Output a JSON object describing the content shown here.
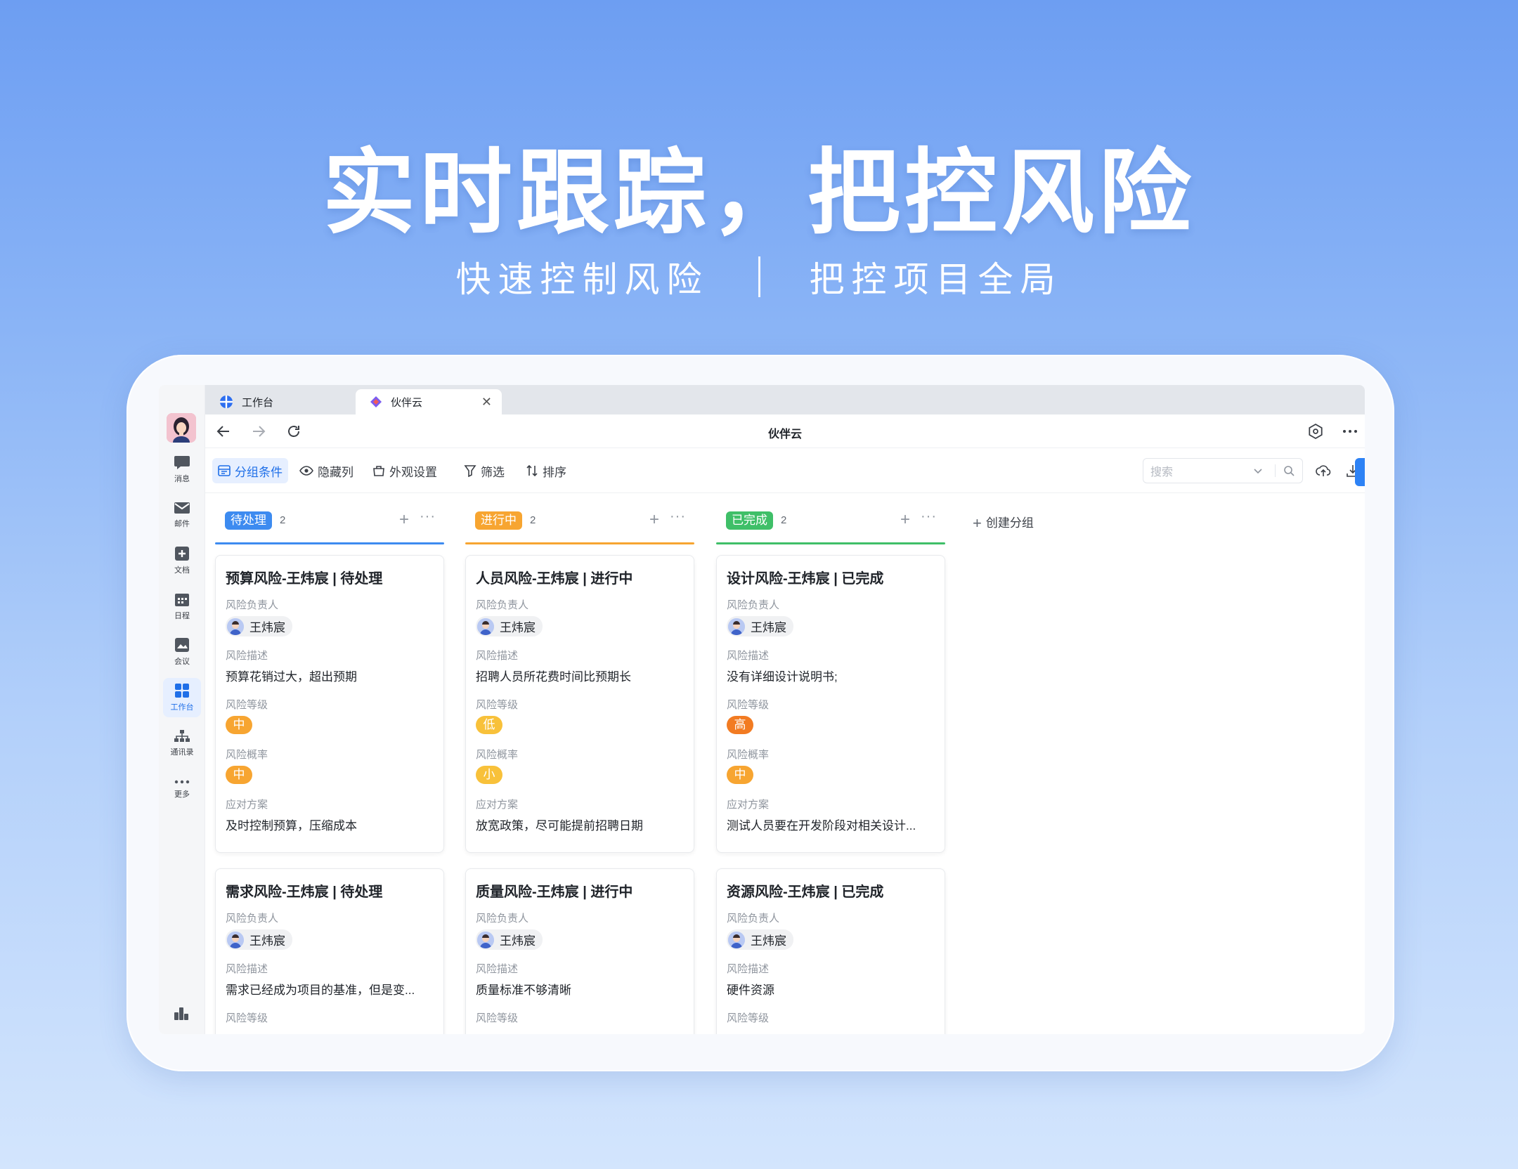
{
  "hero": {
    "title": "实时跟踪，把控风险",
    "subtitle_left": "快速控制风险",
    "subtitle_right": "把控项目全局"
  },
  "colors": {
    "accent": "#1f6fe8",
    "todo": "#3d8bf0",
    "doing": "#f7a531",
    "done": "#3fbf68",
    "level_mid": "#f7a531",
    "level_low": "#f8c13a",
    "level_high": "#f27b22"
  },
  "rail": {
    "items": [
      {
        "label": "消息",
        "icon": "message-icon"
      },
      {
        "label": "邮件",
        "icon": "mail-icon"
      },
      {
        "label": "文档",
        "icon": "doc-icon"
      },
      {
        "label": "日程",
        "icon": "calendar-icon"
      },
      {
        "label": "会议",
        "icon": "meeting-icon"
      },
      {
        "label": "工作台",
        "icon": "workbench-icon"
      },
      {
        "label": "通讯录",
        "icon": "contacts-icon"
      },
      {
        "label": "更多",
        "icon": "more-icon"
      }
    ]
  },
  "browser": {
    "tabs": [
      {
        "label": "工作台"
      },
      {
        "label": "伙伴云"
      }
    ],
    "title": "伙伴云"
  },
  "toolbar": {
    "group": "分组条件",
    "hide": "隐藏列",
    "appearance": "外观设置",
    "filter": "筛选",
    "sort": "排序",
    "search_placeholder": "搜索"
  },
  "board": {
    "create_group": "创建分组",
    "groups": [
      {
        "name": "待处理",
        "count": "2",
        "cards": [
          {
            "title": "预算风险-王炜宸 | 待处理",
            "owner_label": "风险负责人",
            "owner": "王炜宸",
            "desc_label": "风险描述",
            "desc": "预算花销过大，超出预期",
            "level_label": "风险等级",
            "level": "中",
            "prob_label": "风险概率",
            "prob": "中",
            "plan_label": "应对方案",
            "plan": "及时控制预算，压缩成本"
          },
          {
            "title": "需求风险-王炜宸 | 待处理",
            "owner_label": "风险负责人",
            "owner": "王炜宸",
            "desc_label": "风险描述",
            "desc": "需求已经成为项目的基准，但是变...",
            "level_label": "风险等级"
          }
        ]
      },
      {
        "name": "进行中",
        "count": "2",
        "cards": [
          {
            "title": "人员风险-王炜宸 | 进行中",
            "owner_label": "风险负责人",
            "owner": "王炜宸",
            "desc_label": "风险描述",
            "desc": "招聘人员所花费时间比预期长",
            "level_label": "风险等级",
            "level": "低",
            "prob_label": "风险概率",
            "prob": "小",
            "plan_label": "应对方案",
            "plan": "放宽政策，尽可能提前招聘日期"
          },
          {
            "title": "质量风险-王炜宸 | 进行中",
            "owner_label": "风险负责人",
            "owner": "王炜宸",
            "desc_label": "风险描述",
            "desc": "质量标准不够清晰",
            "level_label": "风险等级"
          }
        ]
      },
      {
        "name": "已完成",
        "count": "2",
        "cards": [
          {
            "title": "设计风险-王炜宸 | 已完成",
            "owner_label": "风险负责人",
            "owner": "王炜宸",
            "desc_label": "风险描述",
            "desc": "没有详细设计说明书;",
            "level_label": "风险等级",
            "level": "高",
            "prob_label": "风险概率",
            "prob": "中",
            "plan_label": "应对方案",
            "plan": "测试人员要在开发阶段对相关设计..."
          },
          {
            "title": "资源风险-王炜宸 | 已完成",
            "owner_label": "风险负责人",
            "owner": "王炜宸",
            "desc_label": "风险描述",
            "desc": "硬件资源",
            "level_label": "风险等级"
          }
        ]
      }
    ]
  }
}
